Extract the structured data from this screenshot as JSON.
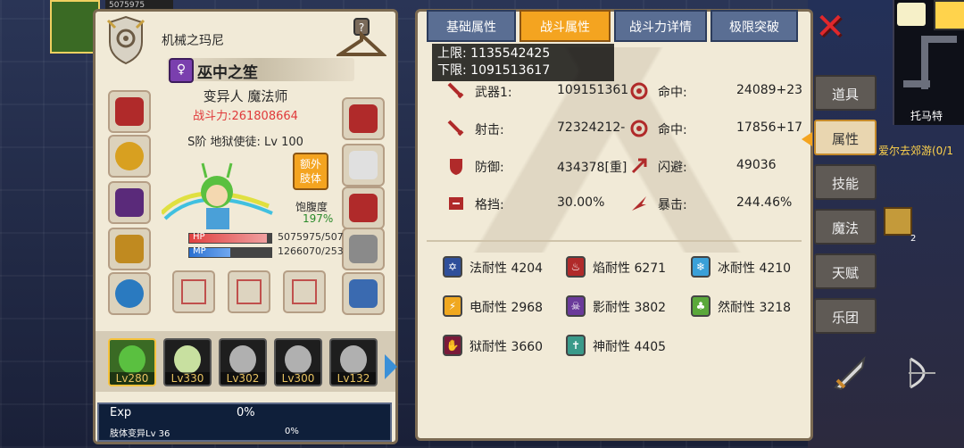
{
  "character": {
    "name": "机械之玛尼",
    "class_name": "巫中之笙",
    "role": "变异人 魔法师",
    "power": "战斗力:261808664",
    "tier": "S阶 地狱使徒: Lv 100",
    "bonus_button": "额外\n肢体",
    "satiety_label": "饱腹度",
    "satiety_value": "197%",
    "hp_label": "HP",
    "hp_value": "5075975/507",
    "mp_label": "MP",
    "mp_value": "1266070/253",
    "hp_fraction": 0.95,
    "mp_fraction": 0.5
  },
  "party": [
    {
      "level": "Lv280",
      "selected": true
    },
    {
      "level": "Lv330",
      "selected": false
    },
    {
      "level": "Lv302",
      "selected": false
    },
    {
      "level": "Lv300",
      "selected": false
    },
    {
      "level": "Lv132",
      "selected": false
    }
  ],
  "exp": {
    "label": "Exp",
    "percent": "0%",
    "sub_label": "肢体变异Lv 36",
    "sub_percent": "0%"
  },
  "top_bar": {
    "hp_text": "5075975"
  },
  "tabs": [
    {
      "label": "基础属性",
      "active": false
    },
    {
      "label": "战斗属性",
      "active": true
    },
    {
      "label": "战斗力详情",
      "active": false
    },
    {
      "label": "极限突破",
      "active": false
    }
  ],
  "tooltip": {
    "upper": "上限: 1135542425",
    "lower": "下限: 1091513617"
  },
  "stats": [
    {
      "label": "武器1:",
      "value": "109151361",
      "icon": "sword-icon"
    },
    {
      "label": "命中:",
      "value": "24089+23",
      "icon": "target-icon"
    },
    {
      "label": "射击:",
      "value": "72324212-",
      "icon": "sword-icon"
    },
    {
      "label": "命中:",
      "value": "17856+17",
      "icon": "target-icon"
    },
    {
      "label": "防御:",
      "value": "434378[重]",
      "icon": "shield-icon"
    },
    {
      "label": "闪避:",
      "value": "49036",
      "icon": "dodge-icon"
    },
    {
      "label": "格挡:",
      "value": "30.00%",
      "icon": "block-icon"
    },
    {
      "label": "暴击:",
      "value": "244.46%",
      "icon": "crit-icon"
    }
  ],
  "resistances": [
    {
      "label": "法耐性 4204",
      "color": "#2f4f9a",
      "glyph": "✡",
      "icon": "magic-resist-icon"
    },
    {
      "label": "焰耐性 6271",
      "color": "#b02a2a",
      "glyph": "♨",
      "icon": "fire-resist-icon"
    },
    {
      "label": "冰耐性 4210",
      "color": "#3aa0d8",
      "glyph": "❄",
      "icon": "ice-resist-icon"
    },
    {
      "label": "电耐性 2968",
      "color": "#f0a820",
      "glyph": "⚡",
      "icon": "lightning-resist-icon"
    },
    {
      "label": "影耐性 3802",
      "color": "#6a3a9a",
      "glyph": "☠",
      "icon": "shadow-resist-icon"
    },
    {
      "label": "然耐性 3218",
      "color": "#5aa83a",
      "glyph": "♣",
      "icon": "nature-resist-icon"
    },
    {
      "label": "狱耐性 3660",
      "color": "#7a1a3a",
      "glyph": "✋",
      "icon": "hell-resist-icon"
    },
    {
      "label": "神耐性 4405",
      "color": "#3a9a8a",
      "glyph": "✝",
      "icon": "divine-resist-icon"
    }
  ],
  "side_tabs": [
    {
      "label": "道具",
      "active": false
    },
    {
      "label": "属性",
      "active": true
    },
    {
      "label": "技能",
      "active": false
    },
    {
      "label": "魔法",
      "active": false
    },
    {
      "label": "天赋",
      "active": false
    },
    {
      "label": "乐团",
      "active": false
    }
  ],
  "world": {
    "map_label": "托马特",
    "quest_text": "爱尔去郊游(0/1",
    "badge_count": "2"
  },
  "colors": {
    "panel_bg": "#f1ead7",
    "accent_orange": "#f4a420",
    "tab_blue": "#5a6e93",
    "power_red": "#e0393a"
  }
}
